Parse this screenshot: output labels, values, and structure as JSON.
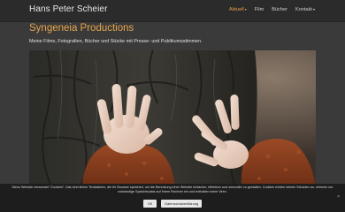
{
  "site": {
    "brand": "Hans Peter Scheier"
  },
  "nav": {
    "items": [
      {
        "label": "Aktuell",
        "dropdown": true,
        "active": true
      },
      {
        "label": "Film",
        "dropdown": false,
        "active": false
      },
      {
        "label": "Bücher",
        "dropdown": false,
        "active": false
      },
      {
        "label": "Kontakt",
        "dropdown": true,
        "active": false
      }
    ],
    "active_color": "#e6a24a"
  },
  "main": {
    "title": "Syngeneia Productions",
    "subtitle": "Meine Filme, Fotografien, Bücher und Stücke mit Presse- und Publikumsstimmen.",
    "hero_icon": "photo-hands-on-tree-bark"
  },
  "cookie": {
    "text": "Diese Website verwendet \"Cookies\". Das sind kleine Textdateien, die Ihr Browser speichert, um die Benutzung einer Website einfacher, effektiver und sinnvoller zu gestalten. Cookies richten keinen Schaden an, nehmen nur notwendige Speicherplatz auf Ihrem Rechner ein und enthalten keine Viren.",
    "ok_label": "OK",
    "privacy_label": "Datenschutzerklärung",
    "dismiss_glyph": "×"
  }
}
